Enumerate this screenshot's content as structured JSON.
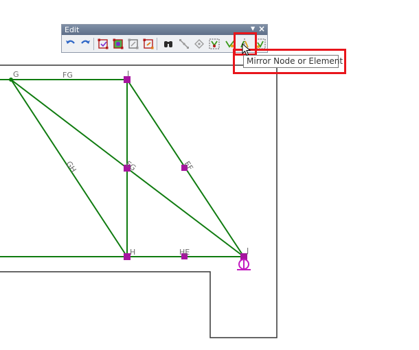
{
  "toolbar": {
    "title": "Edit",
    "dropdown_icon": "dropdown-arrow-icon",
    "close_icon": "close-icon",
    "buttons": [
      {
        "name": "undo-icon"
      },
      {
        "name": "redo-icon"
      },
      {
        "name": "delete-node-icon"
      },
      {
        "name": "merge-nodes-icon"
      },
      {
        "name": "copy-node-icon"
      },
      {
        "name": "move-node-icon"
      },
      {
        "name": "find-icon"
      },
      {
        "name": "divide-element-icon"
      },
      {
        "name": "rotate-node-icon"
      },
      {
        "name": "extrude-icon"
      },
      {
        "name": "scale-icon"
      },
      {
        "name": "mirror-node-or-element-icon"
      },
      {
        "name": "intersect-icon"
      }
    ]
  },
  "tooltip": {
    "text": "Mirror Node or Element"
  },
  "model": {
    "node_labels": [
      "G",
      "I",
      "H",
      "J"
    ],
    "member_labels": [
      "FG",
      "GH",
      "EG",
      "EF",
      "HE"
    ],
    "support_icon": "pin-support-icon"
  },
  "colors": {
    "member": "#0f7b0f",
    "node": "#a6159f",
    "highlight": "#e8151b",
    "boundary": "#333333",
    "label": "#6b6b6b"
  }
}
